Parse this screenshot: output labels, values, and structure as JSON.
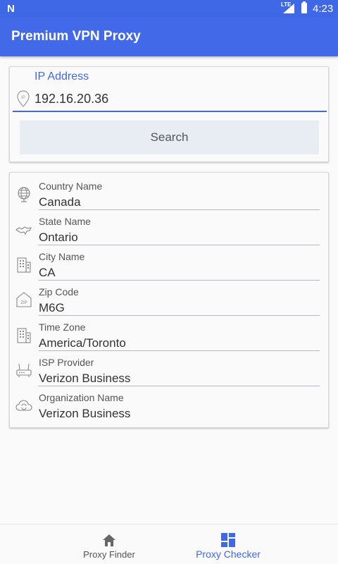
{
  "status": {
    "time": "4:23",
    "network": "LTE"
  },
  "appbar": {
    "title": "Premium VPN Proxy"
  },
  "search": {
    "label": "IP Address",
    "value": "192.16.20.36",
    "button": "Search"
  },
  "info": [
    {
      "label": "Country Name",
      "value": "Canada",
      "icon": "globe-icon"
    },
    {
      "label": "State Name",
      "value": "Ontario",
      "icon": "map-icon"
    },
    {
      "label": "City Name",
      "value": "CA",
      "icon": "building-icon"
    },
    {
      "label": "Zip Code",
      "value": "M6G",
      "icon": "zip-icon"
    },
    {
      "label": "Time Zone",
      "value": "America/Toronto",
      "icon": "building-icon"
    },
    {
      "label": "ISP Provider",
      "value": "Verizon Business",
      "icon": "router-icon"
    },
    {
      "label": "Organization Name",
      "value": "Verizon Business",
      "icon": "cloud-sync-icon"
    }
  ],
  "nav": {
    "finder": "Proxy Finder",
    "checker": "Proxy Checker"
  },
  "colors": {
    "primary": "#4169e8",
    "accent": "#3f68e6"
  }
}
